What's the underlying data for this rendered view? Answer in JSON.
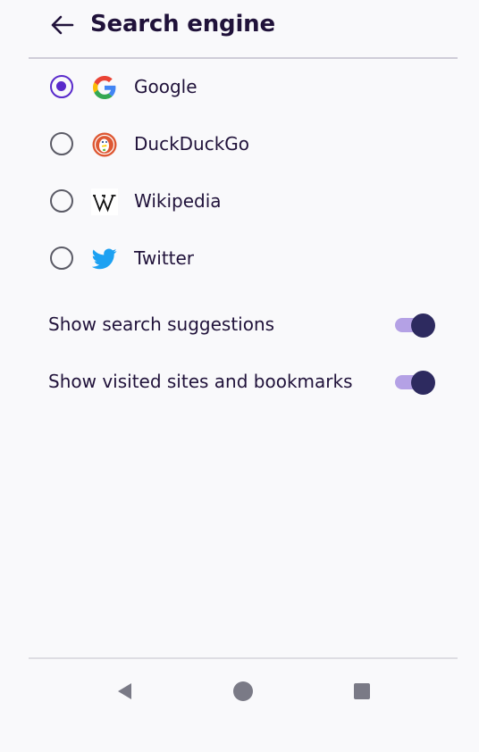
{
  "header": {
    "title": "Search engine",
    "back_icon": "arrow-left-icon"
  },
  "engines": [
    {
      "label": "Google",
      "icon": "google-icon",
      "selected": true
    },
    {
      "label": "DuckDuckGo",
      "icon": "duckduckgo-icon",
      "selected": false
    },
    {
      "label": "Wikipedia",
      "icon": "wikipedia-icon",
      "selected": false
    },
    {
      "label": "Twitter",
      "icon": "twitter-icon",
      "selected": false
    }
  ],
  "toggles": [
    {
      "label": "Show search suggestions",
      "on": true
    },
    {
      "label": "Show visited sites and bookmarks",
      "on": true
    }
  ],
  "nav": {
    "back": "nav-back-icon",
    "home": "nav-home-icon",
    "recents": "nav-recents-icon"
  },
  "colors": {
    "accent": "#592acb",
    "text": "#20123a",
    "toggle_track": "#b4a1e5",
    "toggle_thumb": "#2d2a5f",
    "background": "#f9f9fb"
  }
}
